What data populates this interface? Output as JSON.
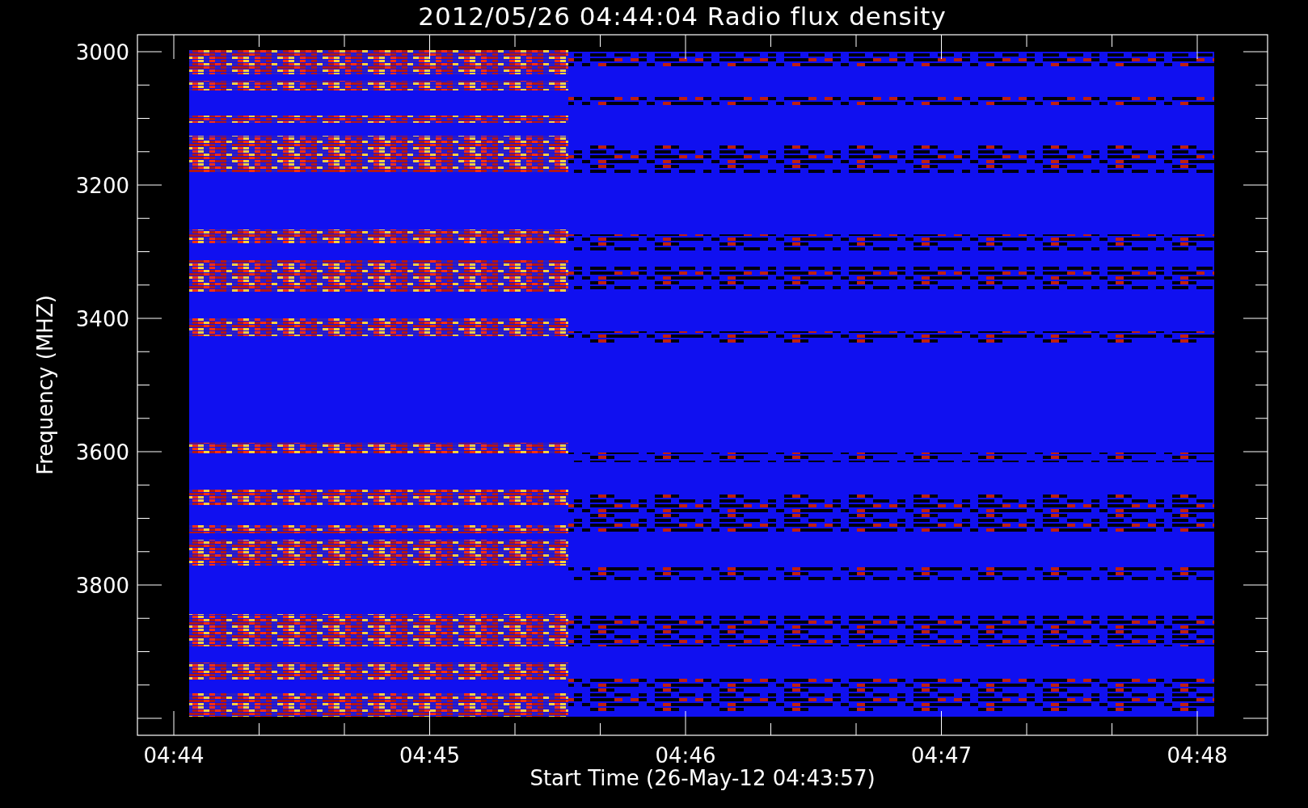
{
  "title": "2012/05/26 04:44:04 Radio flux density",
  "y_axis": {
    "label": "Frequency (MHZ)",
    "ticks": [
      "3000",
      "3200",
      "3400",
      "3600",
      "3800"
    ]
  },
  "x_axis": {
    "label": "Start Time (26-May-12 04:43:57)",
    "ticks": [
      "04:44",
      "04:45",
      "04:46",
      "04:47",
      "04:48"
    ]
  }
}
